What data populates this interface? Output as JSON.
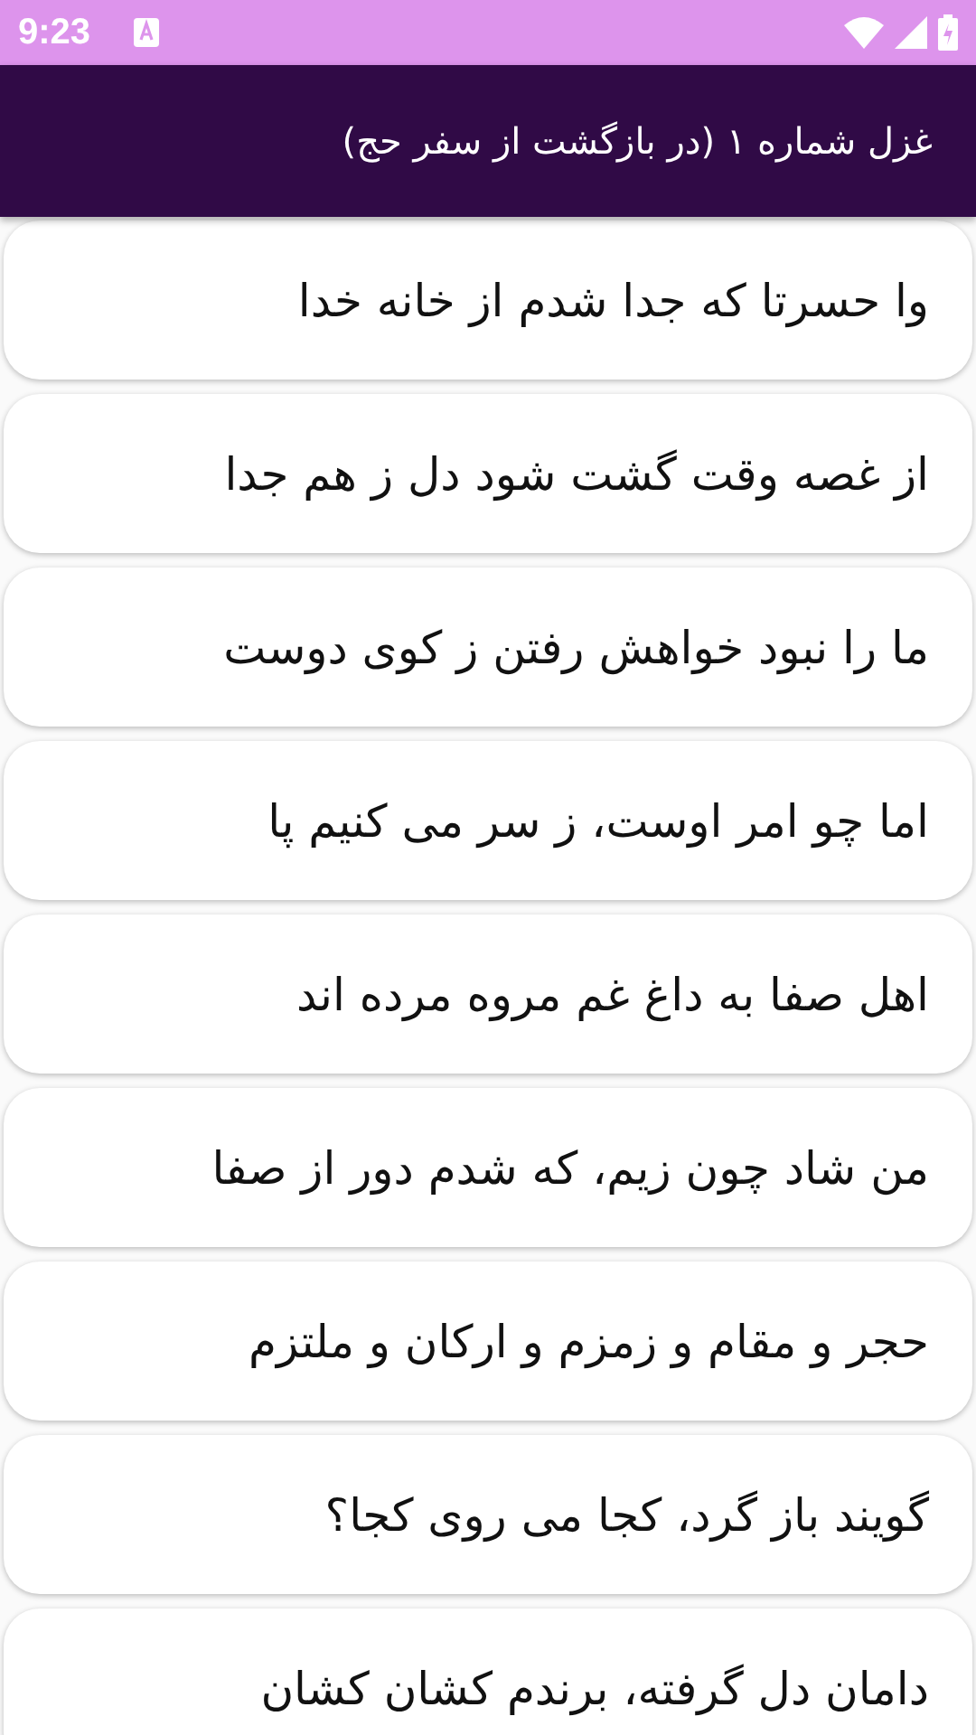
{
  "status_bar": {
    "time": "9:23"
  },
  "app_bar": {
    "title": "غزل شماره ۱ (در بازگشت از سفر حج)"
  },
  "verses": [
    {
      "text": "وا حسرتا که جدا شدم از خانه خدا"
    },
    {
      "text": "از غصه وقت گشت شود دل ز هم جدا"
    },
    {
      "text": "ما را نبود خواهش رفتن ز کوی دوست"
    },
    {
      "text": "اما چو امر اوست، ز سر می کنیم پا"
    },
    {
      "text": "اهل صفا به داغ غم مروه مرده اند"
    },
    {
      "text": "من شاد چون زیم، که شدم دور از صفا"
    },
    {
      "text": "حجر و مقام و زمزم و ارکان و ملتزم"
    },
    {
      "text": "گویند باز گرد، کجا می روی کجا؟"
    },
    {
      "text": "دامان دل گرفته، برندم کشان کشان"
    }
  ]
}
